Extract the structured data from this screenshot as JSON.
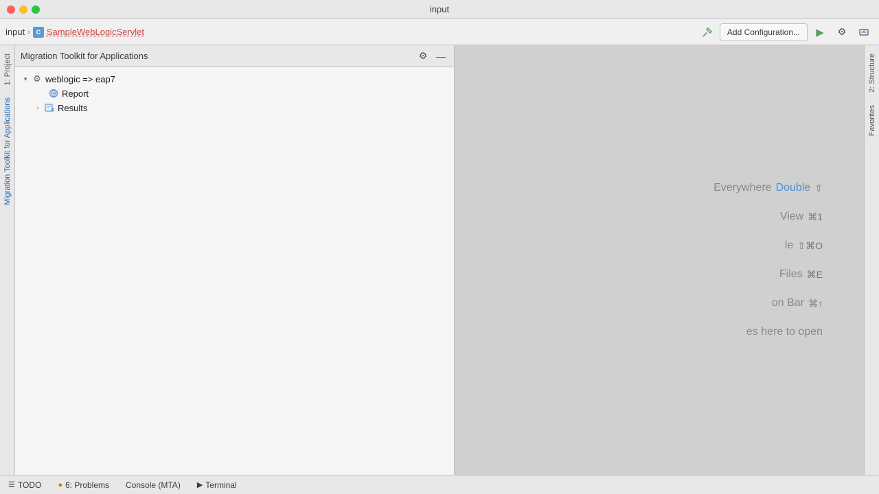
{
  "window": {
    "title": "input"
  },
  "titlebar": {
    "title": "input",
    "close_label": "",
    "min_label": "",
    "max_label": ""
  },
  "navbar": {
    "project_name": "input",
    "separator": "›",
    "class_name": "SampleWebLogicServlet",
    "add_config_label": "Add Configuration...",
    "run_icon": "▶",
    "settings_icon": "⚙",
    "coverage_icon": "⏱"
  },
  "panel": {
    "title": "Migration Toolkit for Applications",
    "settings_label": "⚙",
    "collapse_label": "—"
  },
  "tree": {
    "root": {
      "label": "weblogic => eap7",
      "expanded": true,
      "children": [
        {
          "label": "Report",
          "icon": "globe",
          "has_children": false
        },
        {
          "label": "Results",
          "icon": "results",
          "has_children": true
        }
      ]
    }
  },
  "hints": [
    {
      "text": "Everywhere",
      "action": "Double",
      "key": "⇧"
    },
    {
      "text": "View",
      "action": "",
      "key": "⌘1"
    },
    {
      "text": "le",
      "action": "",
      "key": "⇧⌘O"
    },
    {
      "text": "Files",
      "action": "",
      "key": "⌘E"
    },
    {
      "text": "on Bar",
      "action": "",
      "key": "⌘↑"
    },
    {
      "text": "es here to open",
      "action": "",
      "key": ""
    }
  ],
  "left_tabs": [
    {
      "label": "1: Project",
      "active": false
    },
    {
      "label": "Migration Toolkit for Applications",
      "active": true
    }
  ],
  "right_tabs": [
    {
      "label": "2: Structure",
      "active": false
    },
    {
      "label": "Favorites",
      "active": false
    }
  ],
  "statusbar": {
    "todo_label": "TODO",
    "todo_icon": "☰",
    "problems_label": "6: Problems",
    "problems_icon": "●",
    "console_label": "Console (MTA)",
    "terminal_label": "Terminal",
    "terminal_icon": "▶"
  }
}
